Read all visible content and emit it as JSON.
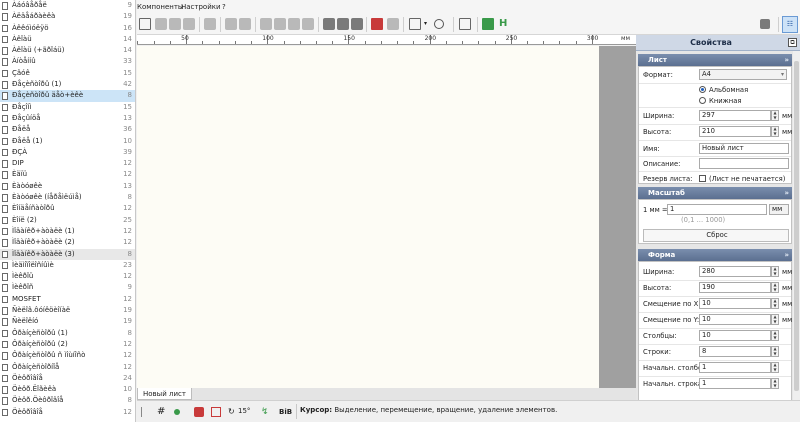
{
  "component_list": [
    {
      "label": "Àáóâåðåë",
      "count": "9"
    },
    {
      "label": "Àëäåáðàèêà",
      "count": "19"
    },
    {
      "label": "Àêêóìóëÿö",
      "count": "16"
    },
    {
      "label": "Àêîàü",
      "count": "14"
    },
    {
      "label": "Àêîàü (+ãðîáü)",
      "count": "14"
    },
    {
      "label": "Àíòåííû",
      "count": "33"
    },
    {
      "label": "Çâóê",
      "count": "15"
    },
    {
      "label": "Ðåçèñòîðû (1)",
      "count": "42"
    },
    {
      "label": "Ðåçèñòîðû äåò+èêè",
      "count": "8"
    },
    {
      "label": "Ðåçîíì",
      "count": "15"
    },
    {
      "label": "Ðåçûíöå",
      "count": "13"
    },
    {
      "label": "Ðåëå",
      "count": "36"
    },
    {
      "label": "Ðåëå (1)",
      "count": "10"
    },
    {
      "label": "ÐÇÀ",
      "count": "39"
    },
    {
      "label": "DIP",
      "count": "12"
    },
    {
      "label": "Èäïü",
      "count": "12"
    },
    {
      "label": "Èàòóøêè",
      "count": "13"
    },
    {
      "label": "Èàòóøêè (íåðåìëúìå)",
      "count": "8"
    },
    {
      "label": "Èîíäåíñàòîðû",
      "count": "12"
    },
    {
      "label": "Èîíë (2)",
      "count": "25"
    },
    {
      "label": "Ìîäàíêð+àòàëè (1)",
      "count": "12"
    },
    {
      "label": "Ìîäàíêð+àòàëè (2)",
      "count": "12"
    },
    {
      "label": "Ìîäàíêð+àòàëè (3)",
      "count": "8"
    },
    {
      "label": "Ìèäìîïîëîñíûìè",
      "count": "23"
    },
    {
      "label": "Ìèêðîü",
      "count": "12"
    },
    {
      "label": "Ìèêðîñ",
      "count": "9"
    },
    {
      "label": "MOSFET",
      "count": "12"
    },
    {
      "label": "Ñèëîâ.ôóíêöèîíàë",
      "count": "19"
    },
    {
      "label": "Ñèëîêíó",
      "count": "19"
    },
    {
      "label": "Ôðàíçèñòîðû (1)",
      "count": "8"
    },
    {
      "label": "Ôðàíçèñòîðû (2)",
      "count": "12"
    },
    {
      "label": "Ôðàíçèñòîðû ñ ìîùíîñò",
      "count": "12"
    },
    {
      "label": "Ôðàíçèñòîðíîå",
      "count": "12"
    },
    {
      "label": "Öèôðîâîå",
      "count": "24"
    },
    {
      "label": "Öèôð.Ëîãèêà",
      "count": "10"
    },
    {
      "label": "Öèôð.Öèôðîâîå",
      "count": "8"
    },
    {
      "label": "Öèôðîâîå",
      "count": "12"
    }
  ],
  "menu": {
    "components": "Компоненты",
    "settings": "Настройки",
    "help": "?"
  },
  "ruler": {
    "unit": "мм",
    "ticks": [
      "50",
      "100",
      "150",
      "200",
      "250",
      "300"
    ]
  },
  "properties": {
    "title": "Свойства",
    "sheet_section": {
      "header": "Лист",
      "format_label": "Формат:",
      "format_value": "A4",
      "orientation_landscape": "Альбомная",
      "orientation_portrait": "Книжная",
      "width_label": "Ширина:",
      "width_value": "297",
      "width_unit": "мм",
      "height_label": "Высота:",
      "height_value": "210",
      "height_unit": "мм",
      "name_label": "Имя:",
      "name_value": "Новый лист",
      "description_label": "Описание:",
      "description_value": "",
      "reserve_label": "Резерв листа:",
      "reserve_checkbox_label": "(Лист не печатается)"
    },
    "scale_section": {
      "header": "Масштаб",
      "scale_label": "1 мм =",
      "scale_value": "1",
      "scale_unit": "мм",
      "scale_hint": "(0,1 ... 1000)",
      "reset_label": "Сброс"
    },
    "shape_section": {
      "header": "Форма",
      "width_label": "Ширина:",
      "width_value": "280",
      "width_unit": "мм",
      "height_label": "Высота:",
      "height_value": "190",
      "height_unit": "мм",
      "offset_x_label": "Смещение по X:",
      "offset_x_value": "10",
      "offset_x_unit": "мм",
      "offset_y_label": "Смещение по Y:",
      "offset_y_value": "10",
      "offset_y_unit": "мм",
      "columns_label": "Столбцы:",
      "columns_value": "10",
      "rows_label": "Строки:",
      "rows_value": "8",
      "start_column_label": "Начальн. столбец:",
      "start_column_value": "1",
      "start_row_label": "Начальн. строка:",
      "start_row_value": "1"
    }
  },
  "sheet_tab": "Новый лист",
  "status": {
    "angle": "15°",
    "cursor_label": "Курсор:",
    "cursor_text": "Выделение, перемещение, вращение, удаление элементов."
  }
}
